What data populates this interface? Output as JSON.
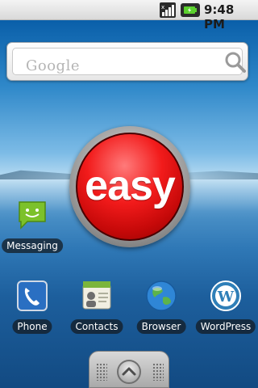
{
  "status_bar": {
    "time": "9:48 PM",
    "icons": [
      "signal-bars-icon",
      "battery-charging-icon"
    ]
  },
  "search_widget": {
    "placeholder": "Google",
    "icon": "magnifier-icon"
  },
  "easy_button": {
    "label": "easy",
    "color": "#e31414"
  },
  "apps": [
    {
      "label": "Messaging",
      "icon": "messaging-icon"
    },
    {
      "label": "Phone",
      "icon": "phone-icon"
    },
    {
      "label": "Contacts",
      "icon": "contacts-icon"
    },
    {
      "label": "Browser",
      "icon": "globe-icon"
    },
    {
      "label": "WordPress",
      "icon": "wordpress-icon"
    }
  ],
  "drawer": {
    "icon": "chevron-up-icon"
  }
}
